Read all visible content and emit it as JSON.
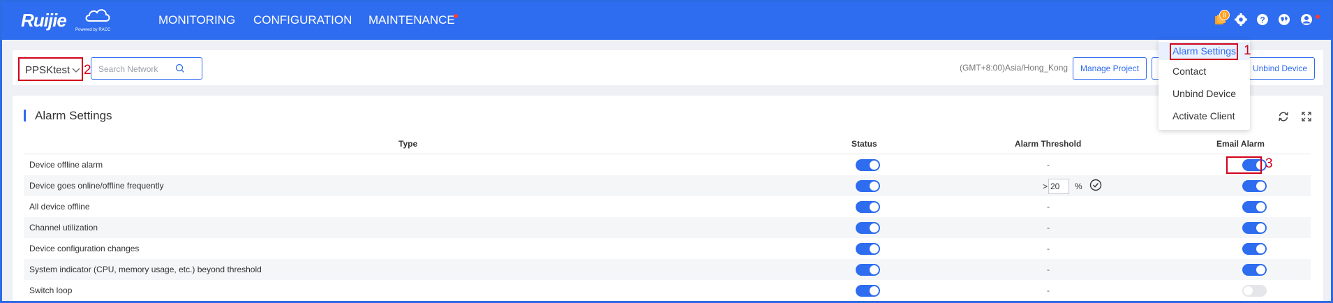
{
  "app": {
    "brand": "Ruijie",
    "brand_sub": "Powered by RACC"
  },
  "nav": {
    "items": [
      "MONITORING",
      "CONFIGURATION",
      "MAINTENANCE"
    ]
  },
  "header_icons": {
    "notification_count": "8",
    "icons": [
      "bell-icon",
      "gear-icon",
      "help-icon",
      "globe-icon",
      "user-icon"
    ]
  },
  "toolbar": {
    "project_selected": "PPSKtest",
    "search_placeholder": "Search Network",
    "timezone": "(GMT+8:00)Asia/Hong_Kong",
    "manage_project_label": "Manage Project",
    "unbind_device_label": "Unbind Device"
  },
  "dropdown": {
    "items": [
      "Alarm Settings",
      "Contact",
      "Unbind Device",
      "Activate Client"
    ]
  },
  "annotations": {
    "one": "1",
    "two": "2",
    "three": "3"
  },
  "main": {
    "title": "Alarm Settings",
    "columns": {
      "type": "Type",
      "status": "Status",
      "threshold": "Alarm Threshold",
      "email": "Email Alarm"
    },
    "rows": [
      {
        "type": "Device offline alarm",
        "status": true,
        "threshold": "-",
        "email": true
      },
      {
        "type": "Device goes online/offline frequently",
        "status": true,
        "threshold_prefix": ">",
        "threshold_value": "20",
        "threshold_unit": "%",
        "email": true
      },
      {
        "type": "All device offline",
        "status": true,
        "threshold": "-",
        "email": true
      },
      {
        "type": "Channel utilization",
        "status": true,
        "threshold": "-",
        "email": true
      },
      {
        "type": "Device configuration changes",
        "status": true,
        "threshold": "-",
        "email": true
      },
      {
        "type": "System indicator (CPU, memory usage, etc.) beyond threshold",
        "status": true,
        "threshold": "-",
        "email": true
      },
      {
        "type": "Switch loop",
        "status": true,
        "threshold": "-",
        "email": false
      }
    ]
  },
  "colors": {
    "primary": "#2e6cf0",
    "annotation": "#d0021b",
    "badge": "#ff9f1c"
  }
}
